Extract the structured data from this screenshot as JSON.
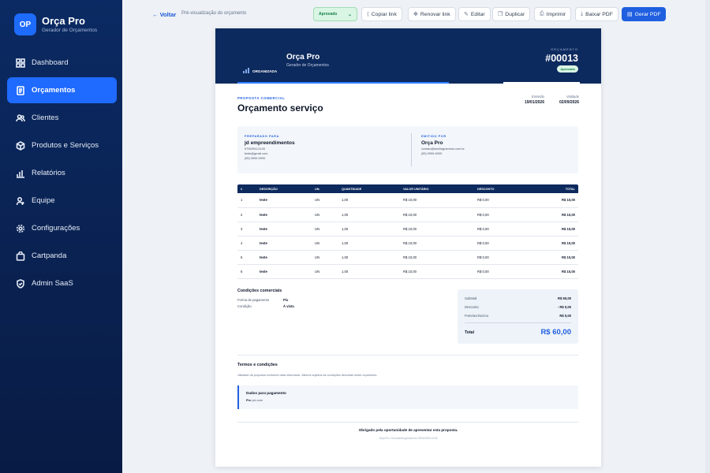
{
  "app": {
    "logo": "OP",
    "name": "Orça Pro",
    "subtitle": "Gerador de Orçamentos"
  },
  "sidebar": {
    "items": [
      {
        "label": "Dashboard",
        "icon": "grid-icon"
      },
      {
        "label": "Orçamentos",
        "icon": "document-icon",
        "active": true
      },
      {
        "label": "Clientes",
        "icon": "users-icon"
      },
      {
        "label": "Produtos e Serviços",
        "icon": "box-icon"
      },
      {
        "label": "Relatórios",
        "icon": "bar-chart-icon"
      },
      {
        "label": "Equipe",
        "icon": "user-team-icon"
      },
      {
        "label": "Configurações",
        "icon": "gear-icon"
      },
      {
        "label": "Cartpanda",
        "icon": "bag-icon"
      },
      {
        "label": "Admin SaaS",
        "icon": "shield-icon"
      }
    ]
  },
  "toolbar": {
    "back": "Voltar",
    "breadcrumb": "Pré-visualização do orçamento",
    "status": "Aprovado",
    "copy_link": "Copiar link",
    "renew_link": "Renovar link",
    "edit": "Editar",
    "duplicate": "Duplicar",
    "print": "Imprimir",
    "download_pdf": "Baixar PDF",
    "generate_pdf": "Gerar PDF"
  },
  "doc": {
    "company_name": "Orça Pro",
    "company_sub": "Gerador de Orçamentos",
    "logo_text": "ORGANIZADA",
    "quote_label": "ORÇAMENTO",
    "quote_number": "#00013",
    "status": "Aprovado",
    "kicker": "PROPOSTA COMERCIAL",
    "title": "Orçamento serviço",
    "issued_label": "Emissão",
    "issued": "19/01/2026",
    "valid_label": "Validade",
    "valid": "02/09/2026",
    "prepared_label": "PREPARADO PARA",
    "client_name": "jd empreendimentos",
    "client_doc": "57069911/1105",
    "client_email": "teste@gmail.com",
    "client_phone": "(55) 9999-9999",
    "issuer_label": "EMITIDO POR",
    "issuer_name": "Orça Pro",
    "issuer_email": "contato@lacrillagramhun.com.br",
    "issuer_phone": "(55) 9999-9999",
    "table": {
      "headers": [
        "#",
        "DESCRIÇÃO",
        "UN.",
        "QUANTIDADE",
        "VALOR UNITÁRIO",
        "DESCONTO",
        "TOTAL"
      ],
      "rows": [
        [
          "1",
          "teste",
          "UN",
          "1,00",
          "R$ 10,00",
          "R$ 0,00",
          "R$ 10,00"
        ],
        [
          "2",
          "teste",
          "UN",
          "1,00",
          "R$ 10,00",
          "R$ 0,00",
          "R$ 10,00"
        ],
        [
          "3",
          "teste",
          "UN",
          "1,00",
          "R$ 10,00",
          "R$ 0,00",
          "R$ 10,00"
        ],
        [
          "4",
          "teste",
          "UN",
          "1,00",
          "R$ 10,00",
          "R$ 0,00",
          "R$ 10,00"
        ],
        [
          "5",
          "teste",
          "UN",
          "1,00",
          "R$ 10,00",
          "R$ 0,00",
          "R$ 10,00"
        ],
        [
          "6",
          "teste",
          "UN",
          "1,00",
          "R$ 10,00",
          "R$ 0,00",
          "R$ 10,00"
        ]
      ]
    },
    "conditions_title": "Condições comerciais",
    "payment_label": "Forma de pagamento",
    "payment_value": "Pix",
    "condition_label": "Condição",
    "condition_value": "À vista",
    "subtotal_label": "Subtotal",
    "subtotal": "R$ 60,00",
    "discount_label": "Desconto",
    "discount": "- R$ 0,00",
    "shipping_label": "Frete/acréscimo",
    "shipping": "R$ 0,00",
    "total_label": "Total",
    "total": "R$ 60,00",
    "terms_title": "Termos e condições",
    "terms_text": "Validade da proposta conforme data informada. Valores sujeitos às condições descritas neste orçamento.",
    "pay_title": "Dados para pagamento",
    "pay_key_label": "Pix:",
    "pay_key": "pix.com",
    "thanks": "Obrigado pela oportunidade de apresentar esta proposta.",
    "footer": "Orça Pro • Documento gerado em 19/01/2026 13:04"
  },
  "colors": {
    "sidebar": "#0b2a63",
    "accent": "#1f6aff",
    "doc_header": "#0d2a5e",
    "approved": "#17834b"
  }
}
